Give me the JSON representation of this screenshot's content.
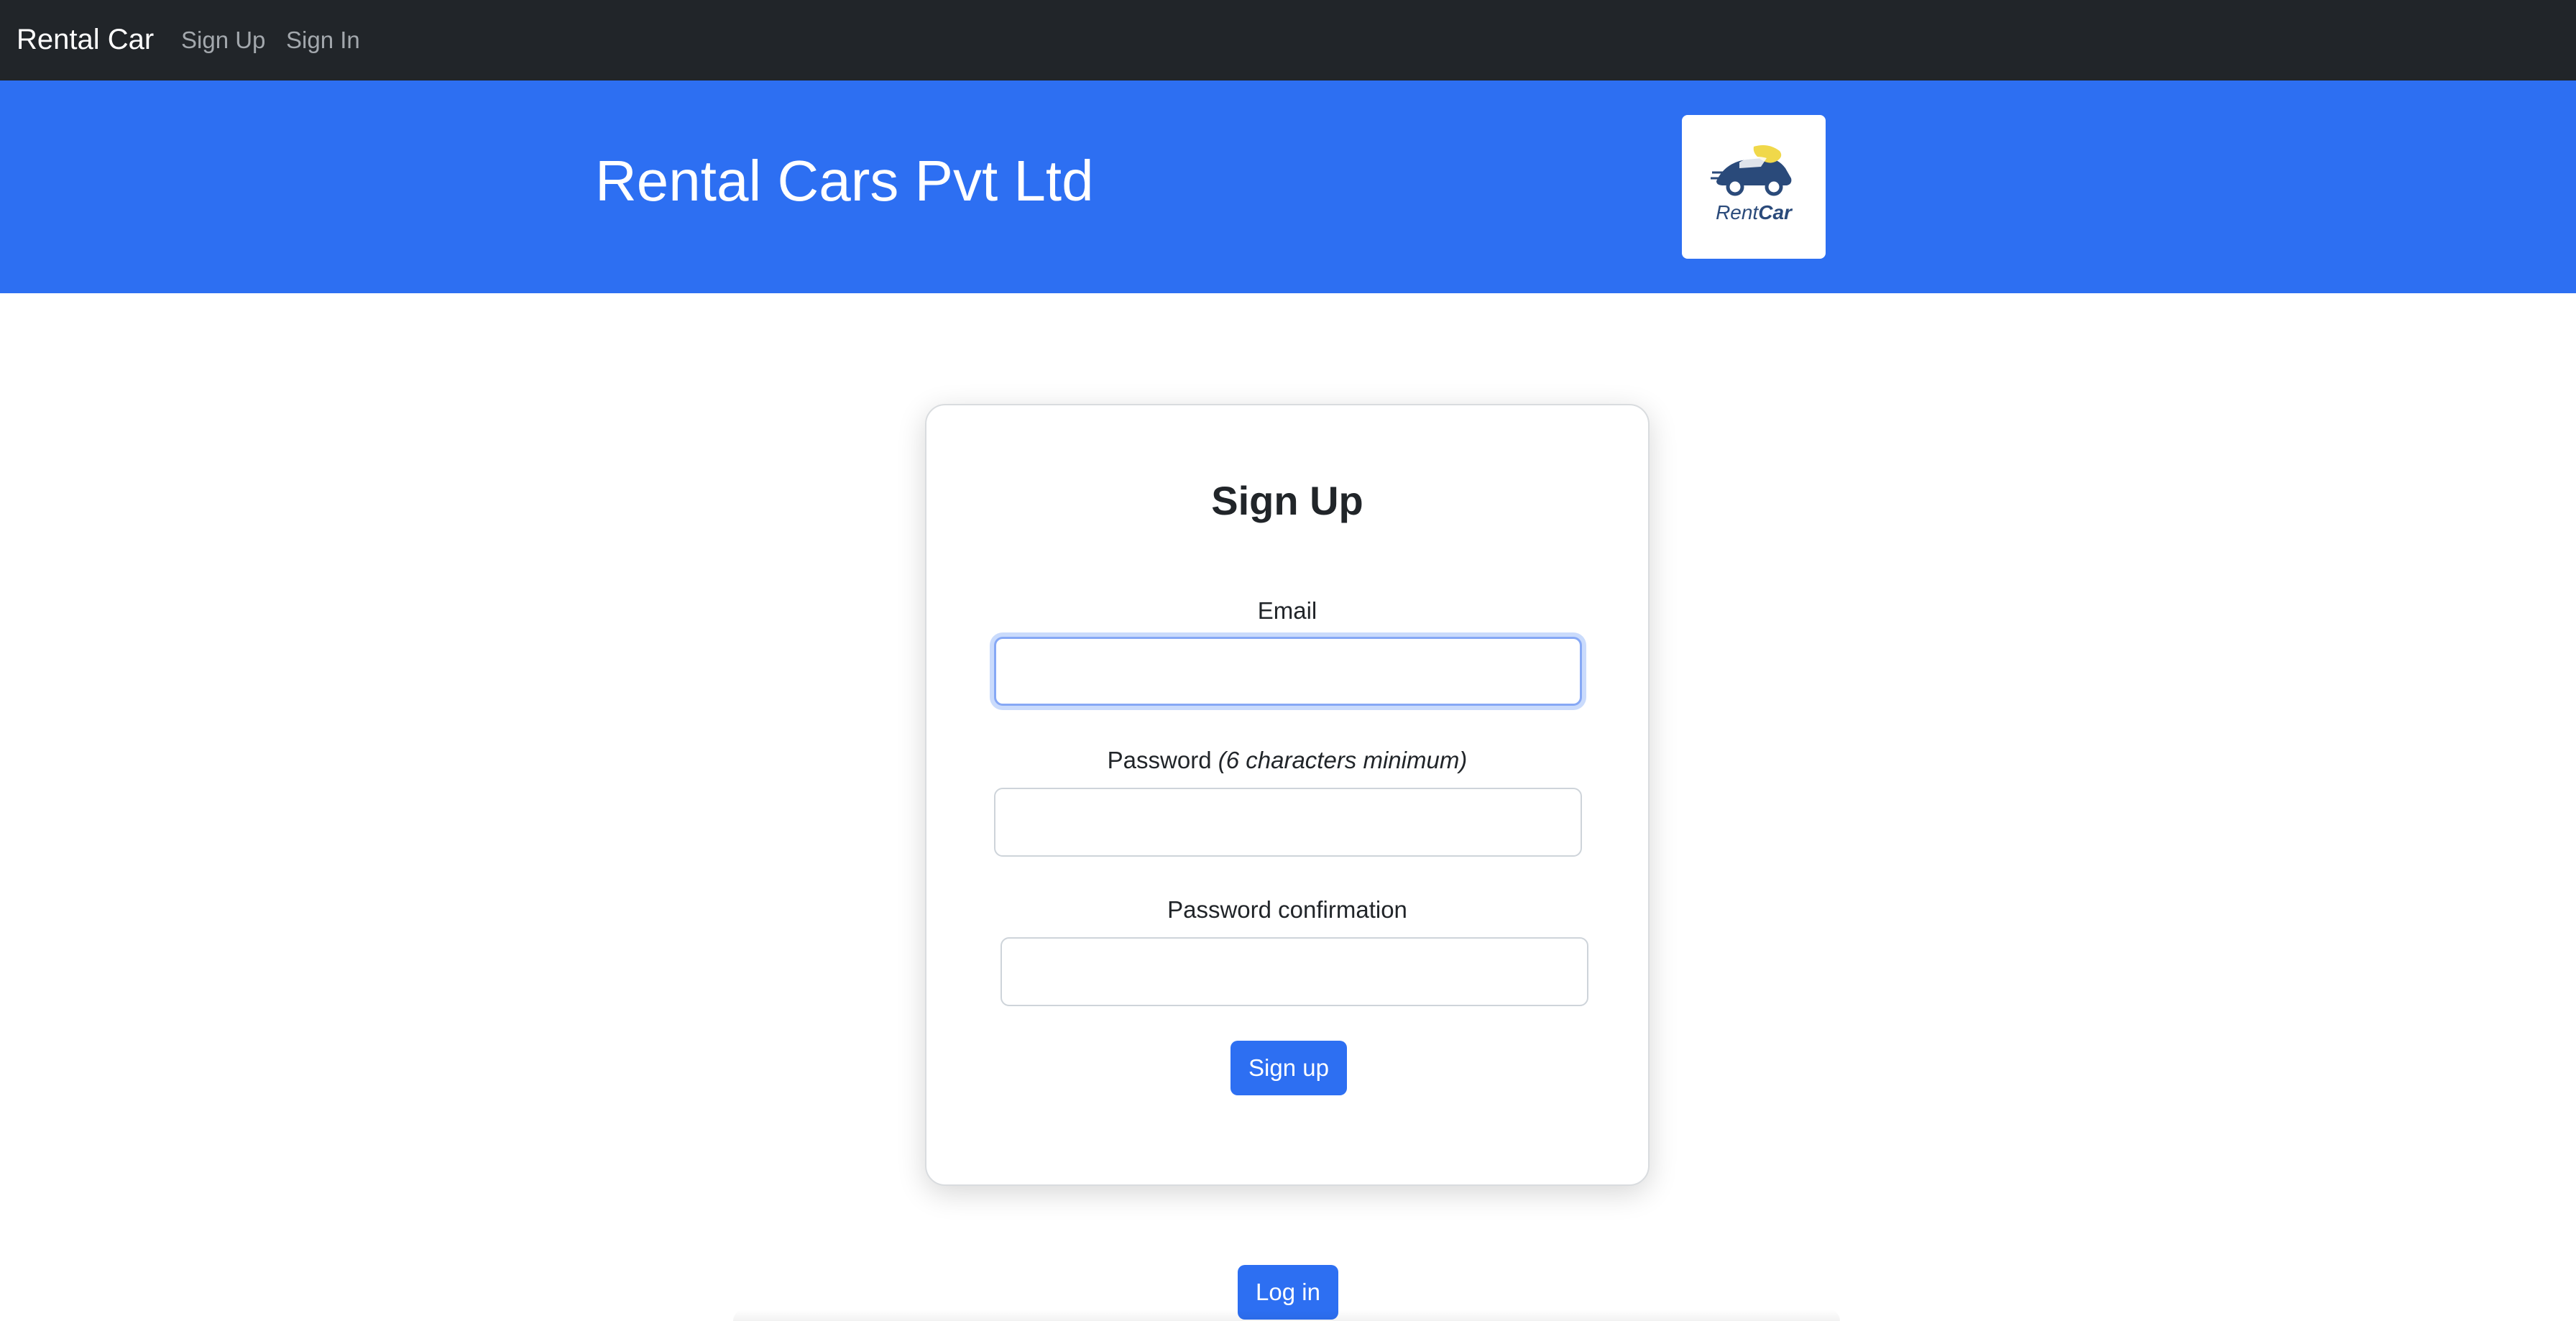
{
  "navbar": {
    "brand": "Rental Car",
    "links": [
      "Sign Up",
      "Sign In"
    ]
  },
  "hero": {
    "title": "Rental Cars Pvt Ltd",
    "logo_text_light": "Rent",
    "logo_text_bold": "Car"
  },
  "form": {
    "title": "Sign Up",
    "email_label": "Email",
    "email_value": "",
    "password_label": "Password",
    "password_hint": "(6 characters minimum)",
    "password_value": "",
    "confirm_label": "Password confirmation",
    "confirm_value": "",
    "submit_label": "Sign up"
  },
  "footer_actions": {
    "login_label": "Log in"
  },
  "colors": {
    "navbar_bg": "#212529",
    "hero_bg": "#2d6ff2",
    "primary": "#2d6ff2",
    "logo_accent": "#f0d84a",
    "logo_dark": "#2a4a7a"
  }
}
